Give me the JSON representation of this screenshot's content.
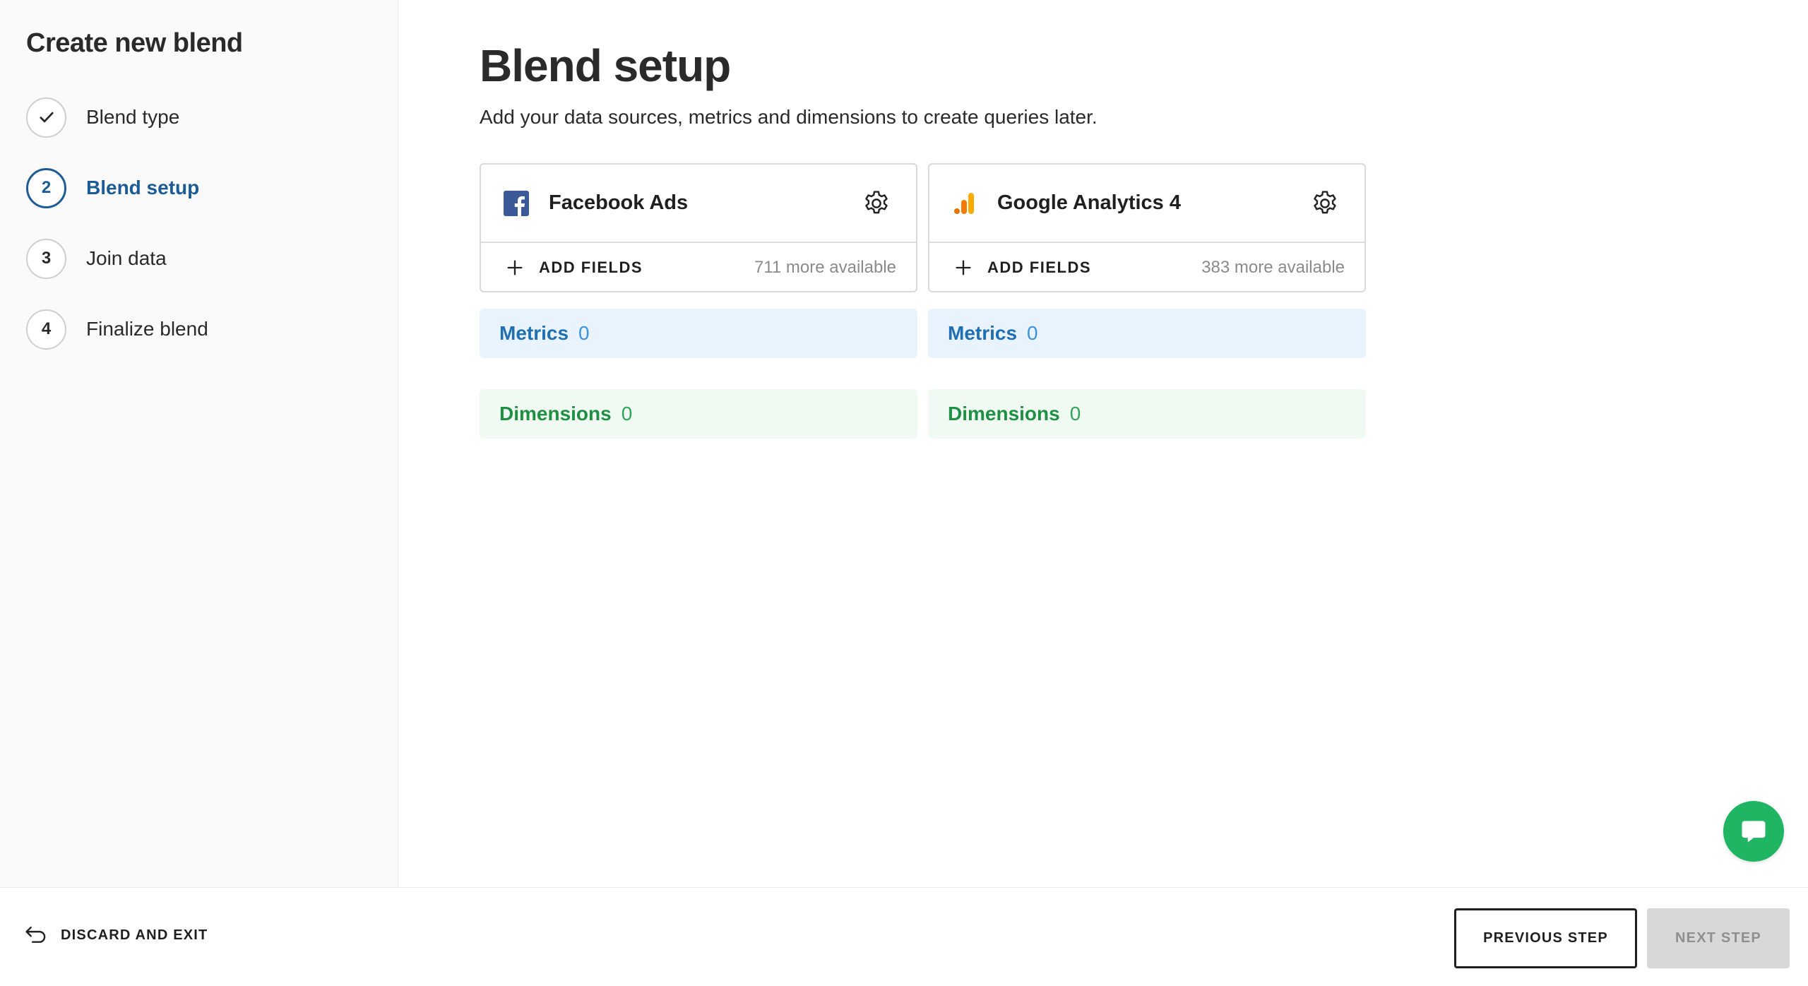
{
  "sidebar": {
    "title": "Create new blend",
    "steps": [
      {
        "number": "",
        "label": "Blend type",
        "state": "completed"
      },
      {
        "number": "2",
        "label": "Blend setup",
        "state": "active"
      },
      {
        "number": "3",
        "label": "Join data",
        "state": "pending"
      },
      {
        "number": "4",
        "label": "Finalize blend",
        "state": "pending"
      }
    ]
  },
  "main": {
    "title": "Blend setup",
    "subtitle": "Add your data sources, metrics and dimensions to create queries later.",
    "sources": [
      {
        "name": "Facebook Ads",
        "logo": "facebook-logo-icon",
        "add_fields_label": "ADD FIELDS",
        "more_available": "711 more available",
        "metrics_label": "Metrics",
        "metrics_count": "0",
        "dimensions_label": "Dimensions",
        "dimensions_count": "0"
      },
      {
        "name": "Google Analytics 4",
        "logo": "google-analytics-logo-icon",
        "add_fields_label": "ADD FIELDS",
        "more_available": "383 more available",
        "metrics_label": "Metrics",
        "metrics_count": "0",
        "dimensions_label": "Dimensions",
        "dimensions_count": "0"
      }
    ]
  },
  "footer": {
    "discard_label": "DISCARD AND EXIT",
    "previous_label": "PREVIOUS STEP",
    "next_label": "NEXT STEP",
    "next_disabled": true
  },
  "colors": {
    "active_step": "#1c5b96",
    "metrics_text": "#1f6fb3",
    "metrics_bg": "#e9f3fd",
    "dimensions_text": "#1f8f43",
    "dimensions_bg": "#f0f9f2",
    "chat_button": "#1fb563",
    "facebook_blue": "#3b5998",
    "analytics_orange": "#f57c00"
  },
  "icons": {
    "chat": "chat-bubble-icon",
    "settings": "gear-icon",
    "add": "plus-icon",
    "discard": "undo-arrow-icon",
    "completed": "checkmark-icon"
  }
}
